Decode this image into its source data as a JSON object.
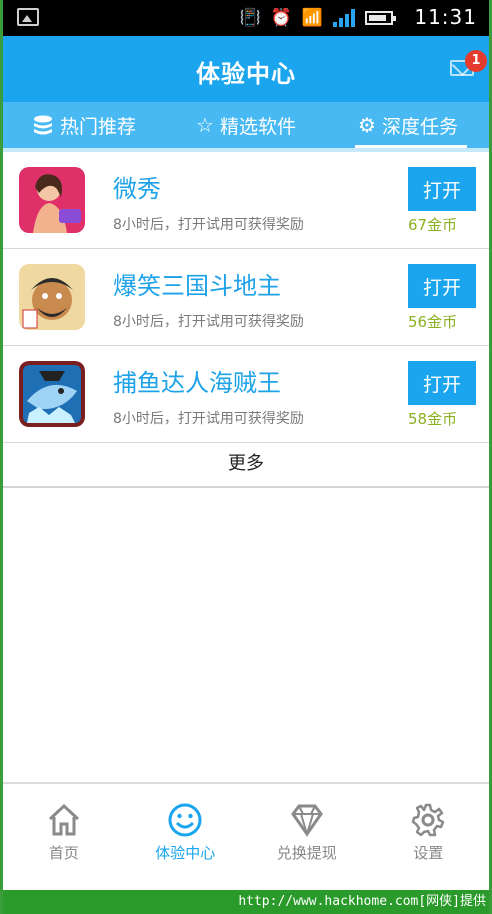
{
  "status_bar": {
    "time": "11:31"
  },
  "header": {
    "title": "体验中心",
    "notification_count": "1"
  },
  "tabs": [
    {
      "label": "热门推荐",
      "icon": "database-icon"
    },
    {
      "label": "精选软件",
      "icon": "star-icon"
    },
    {
      "label": "深度任务",
      "icon": "gear-icon",
      "active": true
    }
  ],
  "apps": [
    {
      "name": "微秀",
      "desc": "8小时后，打开试用可获得奖励",
      "button": "打开",
      "reward": "67金币"
    },
    {
      "name": "爆笑三国斗地主",
      "desc": "8小时后，打开试用可获得奖励",
      "button": "打开",
      "reward": "56金币"
    },
    {
      "name": "捕鱼达人海贼王",
      "desc": "8小时后，打开试用可获得奖励",
      "button": "打开",
      "reward": "58金币"
    }
  ],
  "more_label": "更多",
  "bottom_nav": [
    {
      "label": "首页",
      "icon": "home-icon"
    },
    {
      "label": "体验中心",
      "icon": "smiley-icon",
      "active": true
    },
    {
      "label": "兑换提现",
      "icon": "diamond-icon"
    },
    {
      "label": "设置",
      "icon": "settings-icon"
    }
  ],
  "watermark": "http://www.hackhome.com[网侠]提供",
  "colors": {
    "primary": "#1aa5ee",
    "tabbar": "#48b9f3",
    "coins": "#8bb01f",
    "badge": "#e53b2e"
  }
}
